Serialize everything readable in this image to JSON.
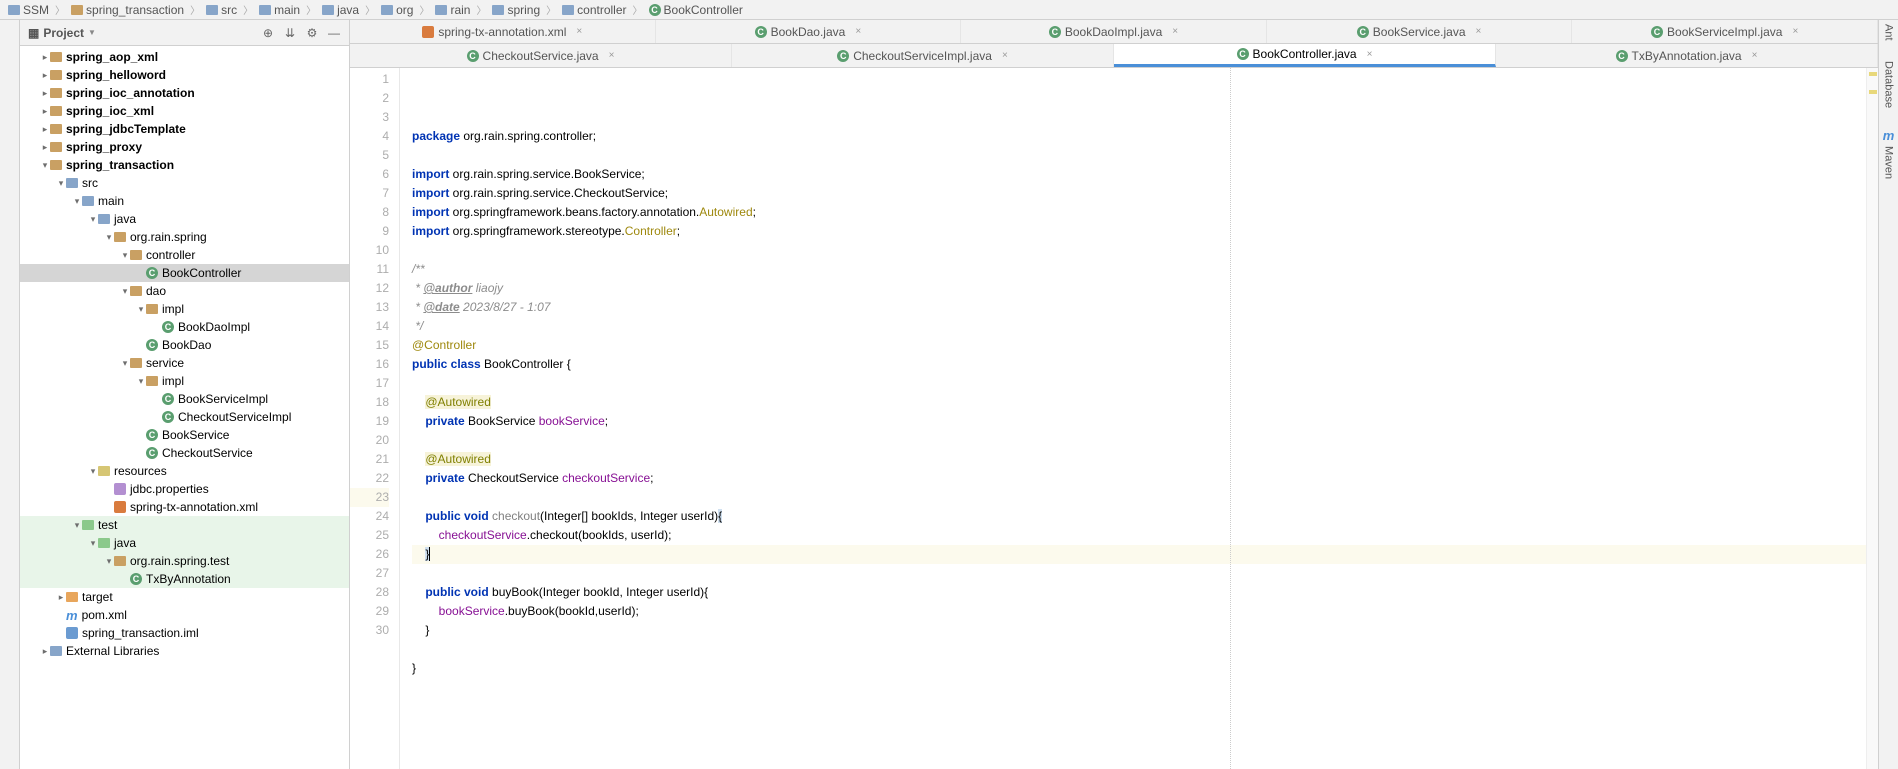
{
  "breadcrumb": [
    "SSM",
    "spring_transaction",
    "src",
    "main",
    "java",
    "org",
    "rain",
    "spring",
    "controller",
    "BookController"
  ],
  "sidebar": {
    "title": "Project",
    "tree": [
      {
        "d": 0,
        "a": "r",
        "ic": "module",
        "t": "spring_aop_xml",
        "bold": true
      },
      {
        "d": 0,
        "a": "r",
        "ic": "module",
        "t": "spring_helloword",
        "bold": true
      },
      {
        "d": 0,
        "a": "r",
        "ic": "module",
        "t": "spring_ioc_annotation",
        "bold": true
      },
      {
        "d": 0,
        "a": "r",
        "ic": "module",
        "t": "spring_ioc_xml",
        "bold": true
      },
      {
        "d": 0,
        "a": "r",
        "ic": "module",
        "t": "spring_jdbcTemplate",
        "bold": true
      },
      {
        "d": 0,
        "a": "r",
        "ic": "module",
        "t": "spring_proxy",
        "bold": true
      },
      {
        "d": 0,
        "a": "d",
        "ic": "module",
        "t": "spring_transaction",
        "bold": true
      },
      {
        "d": 1,
        "a": "d",
        "ic": "folder",
        "t": "src"
      },
      {
        "d": 2,
        "a": "d",
        "ic": "folder",
        "t": "main"
      },
      {
        "d": 3,
        "a": "d",
        "ic": "folder",
        "t": "java"
      },
      {
        "d": 4,
        "a": "d",
        "ic": "pkg",
        "t": "org.rain.spring"
      },
      {
        "d": 5,
        "a": "d",
        "ic": "pkg",
        "t": "controller"
      },
      {
        "d": 6,
        "a": "",
        "ic": "class",
        "t": "BookController",
        "sel": true
      },
      {
        "d": 5,
        "a": "d",
        "ic": "pkg",
        "t": "dao"
      },
      {
        "d": 6,
        "a": "d",
        "ic": "pkg",
        "t": "impl"
      },
      {
        "d": 7,
        "a": "",
        "ic": "class",
        "t": "BookDaoImpl"
      },
      {
        "d": 6,
        "a": "",
        "ic": "class",
        "t": "BookDao"
      },
      {
        "d": 5,
        "a": "d",
        "ic": "pkg",
        "t": "service"
      },
      {
        "d": 6,
        "a": "d",
        "ic": "pkg",
        "t": "impl"
      },
      {
        "d": 7,
        "a": "",
        "ic": "class",
        "t": "BookServiceImpl"
      },
      {
        "d": 7,
        "a": "",
        "ic": "class",
        "t": "CheckoutServiceImpl"
      },
      {
        "d": 6,
        "a": "",
        "ic": "class",
        "t": "BookService"
      },
      {
        "d": 6,
        "a": "",
        "ic": "class",
        "t": "CheckoutService"
      },
      {
        "d": 3,
        "a": "d",
        "ic": "res",
        "t": "resources"
      },
      {
        "d": 4,
        "a": "",
        "ic": "prop",
        "t": "jdbc.properties"
      },
      {
        "d": 4,
        "a": "",
        "ic": "xml",
        "t": "spring-tx-annotation.xml"
      },
      {
        "d": 2,
        "a": "d",
        "ic": "testf",
        "t": "test",
        "test": true
      },
      {
        "d": 3,
        "a": "d",
        "ic": "testf",
        "t": "java",
        "test": true
      },
      {
        "d": 4,
        "a": "d",
        "ic": "pkg",
        "t": "org.rain.spring.test",
        "test": true
      },
      {
        "d": 5,
        "a": "",
        "ic": "class",
        "t": "TxByAnnotation",
        "test": true
      },
      {
        "d": 1,
        "a": "r",
        "ic": "target",
        "t": "target"
      },
      {
        "d": 1,
        "a": "",
        "ic": "m",
        "t": "pom.xml"
      },
      {
        "d": 1,
        "a": "",
        "ic": "iml",
        "t": "spring_transaction.iml"
      },
      {
        "d": -1,
        "a": "r",
        "ic": "lib",
        "t": "External Libraries"
      }
    ]
  },
  "tabRows": [
    [
      {
        "ic": "xml",
        "t": "spring-tx-annotation.xml"
      },
      {
        "ic": "class",
        "t": "BookDao.java"
      },
      {
        "ic": "class",
        "t": "BookDaoImpl.java"
      },
      {
        "ic": "class",
        "t": "BookService.java"
      },
      {
        "ic": "class",
        "t": "BookServiceImpl.java"
      }
    ],
    [
      {
        "ic": "class",
        "t": "CheckoutService.java"
      },
      {
        "ic": "class",
        "t": "CheckoutServiceImpl.java"
      },
      {
        "ic": "class",
        "t": "BookController.java",
        "active": true
      },
      {
        "ic": "class",
        "t": "TxByAnnotation.java"
      }
    ]
  ],
  "code": {
    "lines": [
      {
        "n": 1,
        "seg": [
          [
            "kw",
            "package "
          ],
          [
            "",
            "org.rain.spring.controller;"
          ]
        ]
      },
      {
        "n": 2,
        "seg": [
          [
            "",
            ""
          ]
        ]
      },
      {
        "n": 3,
        "seg": [
          [
            "kw",
            "import "
          ],
          [
            "",
            "org.rain.spring.service.BookService;"
          ]
        ]
      },
      {
        "n": 4,
        "seg": [
          [
            "kw",
            "import "
          ],
          [
            "",
            "org.rain.spring.service.CheckoutService;"
          ]
        ]
      },
      {
        "n": 5,
        "seg": [
          [
            "kw",
            "import "
          ],
          [
            "",
            "org.springframework.beans.factory.annotation."
          ],
          [
            "ann",
            "Autowired"
          ],
          [
            "",
            ";"
          ]
        ]
      },
      {
        "n": 6,
        "seg": [
          [
            "kw",
            "import "
          ],
          [
            "",
            "org.springframework.stereotype."
          ],
          [
            "ann",
            "Controller"
          ],
          [
            "",
            ";"
          ]
        ]
      },
      {
        "n": 7,
        "seg": [
          [
            "",
            ""
          ]
        ]
      },
      {
        "n": 8,
        "seg": [
          [
            "cmt",
            "/**"
          ]
        ]
      },
      {
        "n": 9,
        "seg": [
          [
            "cmt",
            " * "
          ],
          [
            "cmt-tag",
            "@author"
          ],
          [
            "cmt",
            " liaojy"
          ]
        ]
      },
      {
        "n": 10,
        "seg": [
          [
            "cmt",
            " * "
          ],
          [
            "cmt-tag",
            "@date"
          ],
          [
            "cmt",
            " 2023/8/27 - 1:07"
          ]
        ]
      },
      {
        "n": 11,
        "seg": [
          [
            "cmt",
            " */"
          ]
        ]
      },
      {
        "n": 12,
        "seg": [
          [
            "ann",
            "@Controller"
          ]
        ]
      },
      {
        "n": 13,
        "seg": [
          [
            "kw",
            "public class "
          ],
          [
            "cls",
            "BookController {"
          ]
        ]
      },
      {
        "n": 14,
        "seg": [
          [
            "",
            ""
          ]
        ]
      },
      {
        "n": 15,
        "seg": [
          [
            "",
            "    "
          ],
          [
            "ann-bg",
            "@Autowired"
          ]
        ]
      },
      {
        "n": 16,
        "seg": [
          [
            "",
            "    "
          ],
          [
            "kw",
            "private "
          ],
          [
            "",
            "BookService "
          ],
          [
            "fld",
            "bookService"
          ],
          [
            "",
            ";"
          ]
        ]
      },
      {
        "n": 17,
        "seg": [
          [
            "",
            ""
          ]
        ]
      },
      {
        "n": 18,
        "seg": [
          [
            "",
            "    "
          ],
          [
            "ann-bg",
            "@Autowired"
          ]
        ]
      },
      {
        "n": 19,
        "seg": [
          [
            "",
            "    "
          ],
          [
            "kw",
            "private "
          ],
          [
            "",
            "CheckoutService "
          ],
          [
            "fld",
            "checkoutService"
          ],
          [
            "",
            ";"
          ]
        ]
      },
      {
        "n": 20,
        "seg": [
          [
            "",
            ""
          ]
        ]
      },
      {
        "n": 21,
        "seg": [
          [
            "",
            "    "
          ],
          [
            "kw",
            "public void "
          ],
          [
            "mth-unused",
            "checkout"
          ],
          [
            "",
            "(Integer[] bookIds, Integer userId)"
          ],
          [
            "hl-brace",
            "{"
          ]
        ]
      },
      {
        "n": 22,
        "seg": [
          [
            "",
            "        "
          ],
          [
            "fld",
            "checkoutService"
          ],
          [
            "",
            ".checkout(bookIds, userId);"
          ]
        ]
      },
      {
        "n": 23,
        "cur": true,
        "seg": [
          [
            "",
            "    "
          ],
          [
            "hl-brace",
            "}"
          ],
          [
            "caret",
            ""
          ]
        ]
      },
      {
        "n": 24,
        "seg": [
          [
            "",
            ""
          ]
        ]
      },
      {
        "n": 25,
        "seg": [
          [
            "",
            "    "
          ],
          [
            "kw",
            "public void "
          ],
          [
            "mth",
            "buyBook"
          ],
          [
            "",
            "(Integer bookId, Integer userId){"
          ]
        ]
      },
      {
        "n": 26,
        "seg": [
          [
            "",
            "        "
          ],
          [
            "fld",
            "bookService"
          ],
          [
            "",
            ".buyBook(bookId,userId);"
          ]
        ]
      },
      {
        "n": 27,
        "seg": [
          [
            "",
            "    }"
          ]
        ]
      },
      {
        "n": 28,
        "seg": [
          [
            "",
            ""
          ]
        ]
      },
      {
        "n": 29,
        "seg": [
          [
            "",
            "}"
          ]
        ]
      },
      {
        "n": 30,
        "seg": [
          [
            "",
            ""
          ]
        ]
      }
    ]
  },
  "rightRail": [
    "Ant",
    "Database",
    "Maven"
  ]
}
